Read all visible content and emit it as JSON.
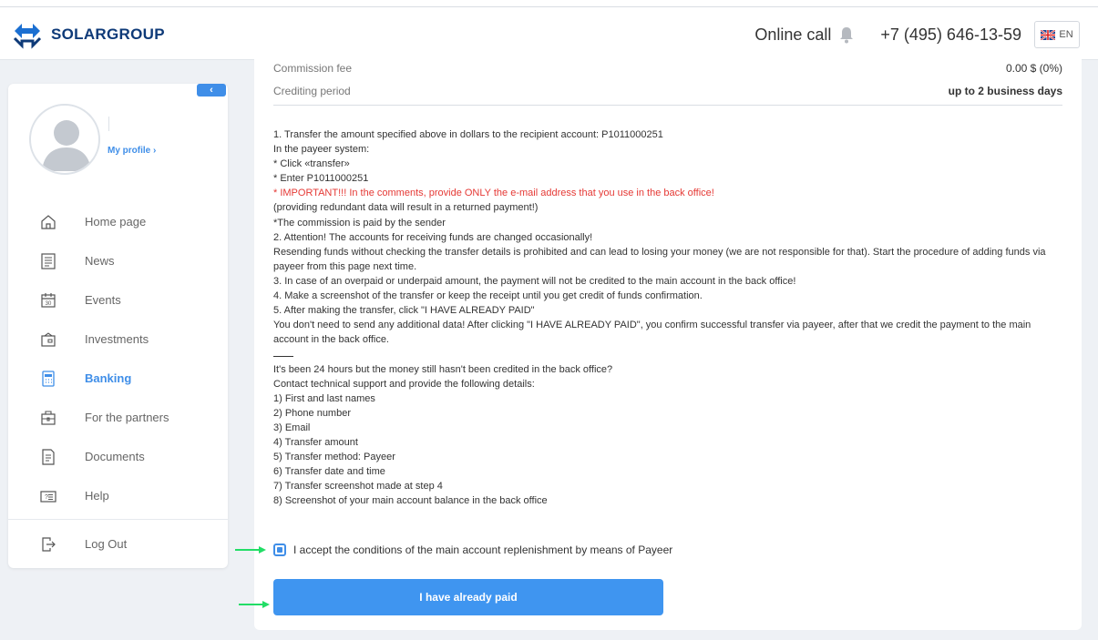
{
  "header": {
    "brand": "SOLARGROUP",
    "online_call": "Online call",
    "phone": "+7 (495) 646-13-59",
    "language": "EN"
  },
  "sidebar": {
    "profile_link": "My profile ›",
    "items": [
      {
        "label": "Home page",
        "icon": "home-icon"
      },
      {
        "label": "News",
        "icon": "news-icon"
      },
      {
        "label": "Events",
        "icon": "calendar-icon"
      },
      {
        "label": "Investments",
        "icon": "investments-icon"
      },
      {
        "label": "Banking",
        "icon": "banking-icon",
        "active": true
      },
      {
        "label": "For the partners",
        "icon": "partners-icon"
      },
      {
        "label": "Documents",
        "icon": "documents-icon"
      },
      {
        "label": "Help",
        "icon": "help-icon"
      }
    ],
    "logout": "Log Out"
  },
  "main": {
    "commission_label": "Commission fee",
    "commission_value": "0.00 $ (0%)",
    "crediting_label": "Crediting period",
    "crediting_value": "up to 2 business days",
    "lines": {
      "l1": "1. Transfer the amount specified above in dollars to the recipient account: P1011000251",
      "l2": "In the payeer system:",
      "l3": "* Click «transfer»",
      "l4": "* Enter P1011000251",
      "l5": "* IMPORTANT!!! In the comments, provide ONLY the e-mail address that you use in the back office!",
      "l6": "(providing redundant data will result in a returned payment!)",
      "l7": "*The commission is paid by the sender",
      "l8": "2. Attention! The accounts for receiving funds are changed occasionally!",
      "l9": "Resending funds without checking the transfer details is prohibited and can lead to losing your money (we are not responsible for that). Start the procedure of adding funds via payeer from this page next time.",
      "l10": "3. In case of an overpaid or underpaid amount, the payment will not be credited to the main  account in the back office!",
      "l11": "4. Make a screenshot of the transfer or keep the receipt until you get credit of funds confirmation.",
      "l12": "5. After making the transfer, click \"I HAVE ALREADY PAID\"",
      "l13": "You don't need to send any additional data! After clicking \"I HAVE ALREADY PAID\", you confirm successful transfer via payeer, after that we credit the payment to the main account in the back office.",
      "l14": "It's been 24 hours but the money still hasn't been credited in the back office?",
      "l15": "Contact technical support and provide the following details:",
      "l16": "1) First and last names",
      "l17": "2) Phone number",
      "l18": "3) Email",
      "l19": "4) Transfer amount",
      "l20": "5) Transfer method: Payeer",
      "l21": "6) Transfer date and time",
      "l22": "7) Transfer screenshot made at step 4",
      "l23": "8) Screenshot of your main account balance in the back office"
    },
    "accept_label": "I accept the conditions of the main account replenishment by means of Payeer",
    "accept_checked": true,
    "pay_button": "I have already paid"
  },
  "colors": {
    "accent": "#3f95f0",
    "warning": "#e53935",
    "arrow": "#22dd66"
  }
}
